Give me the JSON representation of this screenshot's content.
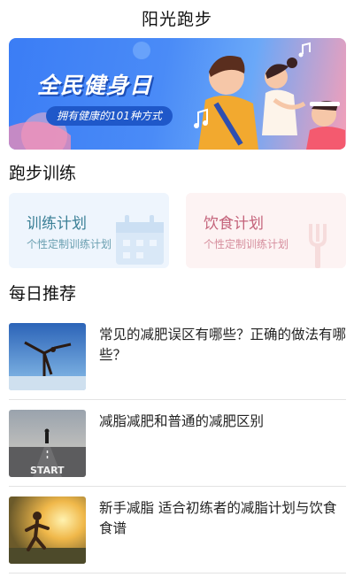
{
  "header": {
    "title": "阳光跑步"
  },
  "banner": {
    "title": "全民健身日",
    "subtitle": "拥有健康的101种方式"
  },
  "sections": {
    "training": "跑步训练",
    "daily": "每日推荐"
  },
  "cards": [
    {
      "title": "训练计划",
      "subtitle": "个性定制训练计划",
      "icon": "calendar-icon"
    },
    {
      "title": "饮食计划",
      "subtitle": "个性定制训练计划",
      "icon": "fork-icon"
    }
  ],
  "articles": [
    {
      "title": "常见的减肥误区有哪些？正确的做法有哪些？",
      "thumb": "gymnast-photo"
    },
    {
      "title": "减脂减肥和普通的减肥区别",
      "thumb": "start-line-photo"
    },
    {
      "title": "新手减脂 适合初练者的减脂计划与饮食食谱",
      "thumb": "runner-sunset-photo"
    }
  ],
  "colors": {
    "banner_blue": "#3b7df5",
    "plan_accent": "#3a7f96",
    "diet_accent": "#c4627a"
  }
}
